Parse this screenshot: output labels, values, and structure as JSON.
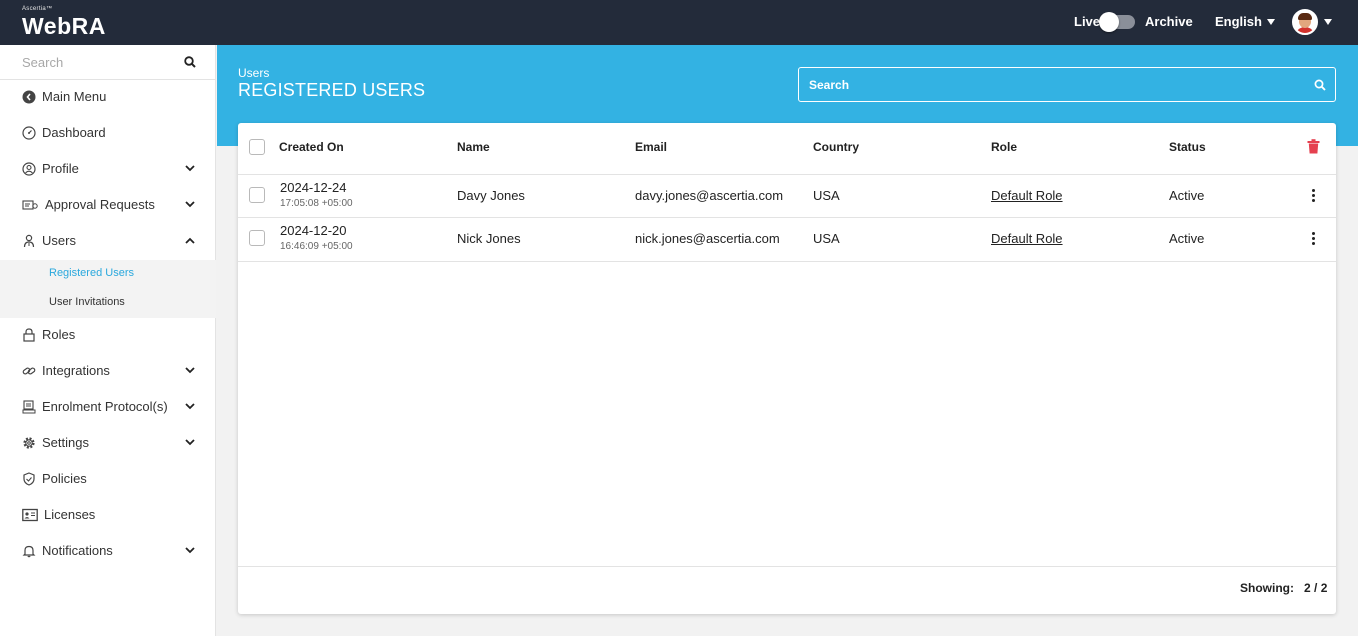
{
  "header": {
    "brand_small": "Ascertia™",
    "brand_main": "WebRA",
    "live_label": "Live",
    "archive_label": "Archive",
    "language": "English"
  },
  "sidebar": {
    "search_placeholder": "Search",
    "items": [
      {
        "label": "Main Menu",
        "icon": "back-circle-icon"
      },
      {
        "label": "Dashboard",
        "icon": "dashboard-icon"
      },
      {
        "label": "Profile",
        "icon": "user-circle-icon"
      },
      {
        "label": "Approval Requests",
        "icon": "approval-icon"
      },
      {
        "label": "Users",
        "icon": "user-icon"
      },
      {
        "label": "Roles",
        "icon": "lock-icon"
      },
      {
        "label": "Integrations",
        "icon": "link-icon"
      },
      {
        "label": "Enrolment Protocol(s)",
        "icon": "protocol-icon"
      },
      {
        "label": "Settings",
        "icon": "gear-icon"
      },
      {
        "label": "Policies",
        "icon": "shield-icon"
      },
      {
        "label": "Licenses",
        "icon": "id-card-icon"
      },
      {
        "label": "Notifications",
        "icon": "bell-icon"
      }
    ],
    "users_sub": [
      {
        "label": "Registered Users",
        "active": true
      },
      {
        "label": "User Invitations",
        "active": false
      }
    ]
  },
  "page": {
    "breadcrumb": "Users",
    "title": "REGISTERED USERS",
    "search_placeholder": "Search"
  },
  "table": {
    "columns": [
      "Created On",
      "Name",
      "Email",
      "Country",
      "Role",
      "Status"
    ],
    "rows": [
      {
        "date": "2024-12-24",
        "time": "17:05:08 +05:00",
        "name": "Davy Jones",
        "email": "davy.jones@ascertia.com",
        "country": "USA",
        "role": "Default Role",
        "status": "Active"
      },
      {
        "date": "2024-12-20",
        "time": "16:46:09 +05:00",
        "name": "Nick Jones",
        "email": "nick.jones@ascertia.com",
        "country": "USA",
        "role": "Default Role",
        "status": "Active"
      }
    ],
    "footer_label": "Showing:",
    "footer_value": "2 / 2"
  },
  "colors": {
    "topbar": "#232b3a",
    "accent": "#33b2e3",
    "active_link": "#2aa8dd",
    "delete": "#e5404f"
  }
}
